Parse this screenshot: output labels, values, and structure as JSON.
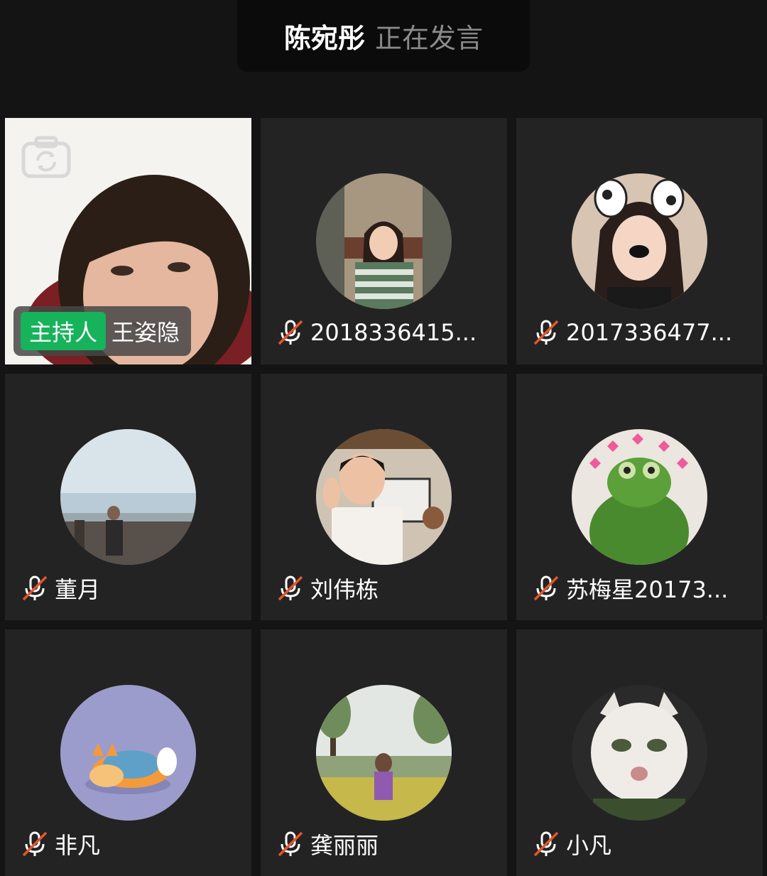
{
  "speaker_banner": {
    "name": "陈宛彤",
    "status": "正在发言"
  },
  "host": {
    "role_label": "主持人",
    "name": "王姿隐"
  },
  "participants": [
    {
      "name": "2018336415...",
      "mic": "muted"
    },
    {
      "name": "2017336477...",
      "mic": "muted"
    },
    {
      "name": "董月",
      "mic": "muted"
    },
    {
      "name": "刘伟栋",
      "mic": "muted"
    },
    {
      "name": "苏梅星20173...",
      "mic": "muted"
    },
    {
      "name": "非凡",
      "mic": "muted"
    },
    {
      "name": "龚丽丽",
      "mic": "muted"
    },
    {
      "name": "小凡",
      "mic": "muted"
    }
  ],
  "icons": {
    "mic_muted": "mic-muted-icon",
    "camera_switch": "camera-switch-icon"
  },
  "colors": {
    "background": "#141414",
    "tile": "#232323",
    "host_badge": "#16b35a",
    "mute_slash": "#e2552f"
  }
}
